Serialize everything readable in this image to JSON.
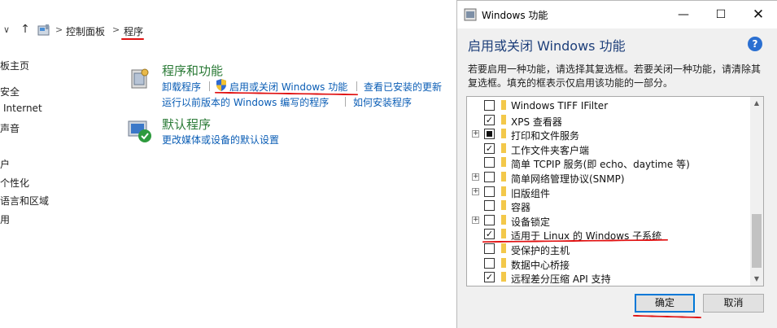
{
  "address_bar": {
    "crumbs": [
      "控制面板",
      "程序"
    ]
  },
  "left_nav": {
    "items": [
      "板主页",
      "安全",
      "Internet",
      "声音",
      "户",
      "个性化",
      "语言和区域",
      "用"
    ]
  },
  "programs_features": {
    "title": "程序和功能",
    "links": [
      "卸载程序",
      "启用或关闭 Windows 功能",
      "查看已安装的更新",
      "运行以前版本的 Windows 编写的程序",
      "如何安装程序"
    ]
  },
  "default_programs": {
    "title": "默认程序",
    "links": [
      "更改媒体或设备的默认设置"
    ]
  },
  "dialog": {
    "window_title": "Windows 功能",
    "heading": "启用或关闭 Windows 功能",
    "help": "?",
    "description": "若要启用一种功能，请选择其复选框。若要关闭一种功能，请清除其复选框。填充的框表示仅启用该功能的一部分。",
    "features": [
      {
        "label": "Windows TIFF IFilter",
        "state": "unchecked",
        "expandable": false
      },
      {
        "label": "XPS 查看器",
        "state": "checked",
        "expandable": false
      },
      {
        "label": "打印和文件服务",
        "state": "partial",
        "expandable": true
      },
      {
        "label": "工作文件夹客户端",
        "state": "checked",
        "expandable": false
      },
      {
        "label": "简单 TCPIP 服务(即 echo、daytime 等)",
        "state": "unchecked",
        "expandable": false
      },
      {
        "label": "简单网络管理协议(SNMP)",
        "state": "unchecked",
        "expandable": true
      },
      {
        "label": "旧版组件",
        "state": "unchecked",
        "expandable": true
      },
      {
        "label": "容器",
        "state": "unchecked",
        "expandable": false
      },
      {
        "label": "设备锁定",
        "state": "unchecked",
        "expandable": true
      },
      {
        "label": "适用于 Linux 的 Windows 子系统",
        "state": "checked",
        "expandable": false
      },
      {
        "label": "受保护的主机",
        "state": "unchecked",
        "expandable": false
      },
      {
        "label": "数据中心桥接",
        "state": "unchecked",
        "expandable": false
      },
      {
        "label": "远程差分压缩 API 支持",
        "state": "checked",
        "expandable": false
      }
    ],
    "ok_label": "确定",
    "cancel_label": "取消"
  },
  "colors": {
    "annotation_red": "#e01010",
    "link_blue": "#0a5db5",
    "section_green": "#2a7a36",
    "folder_yellow": "#f3c84a"
  }
}
